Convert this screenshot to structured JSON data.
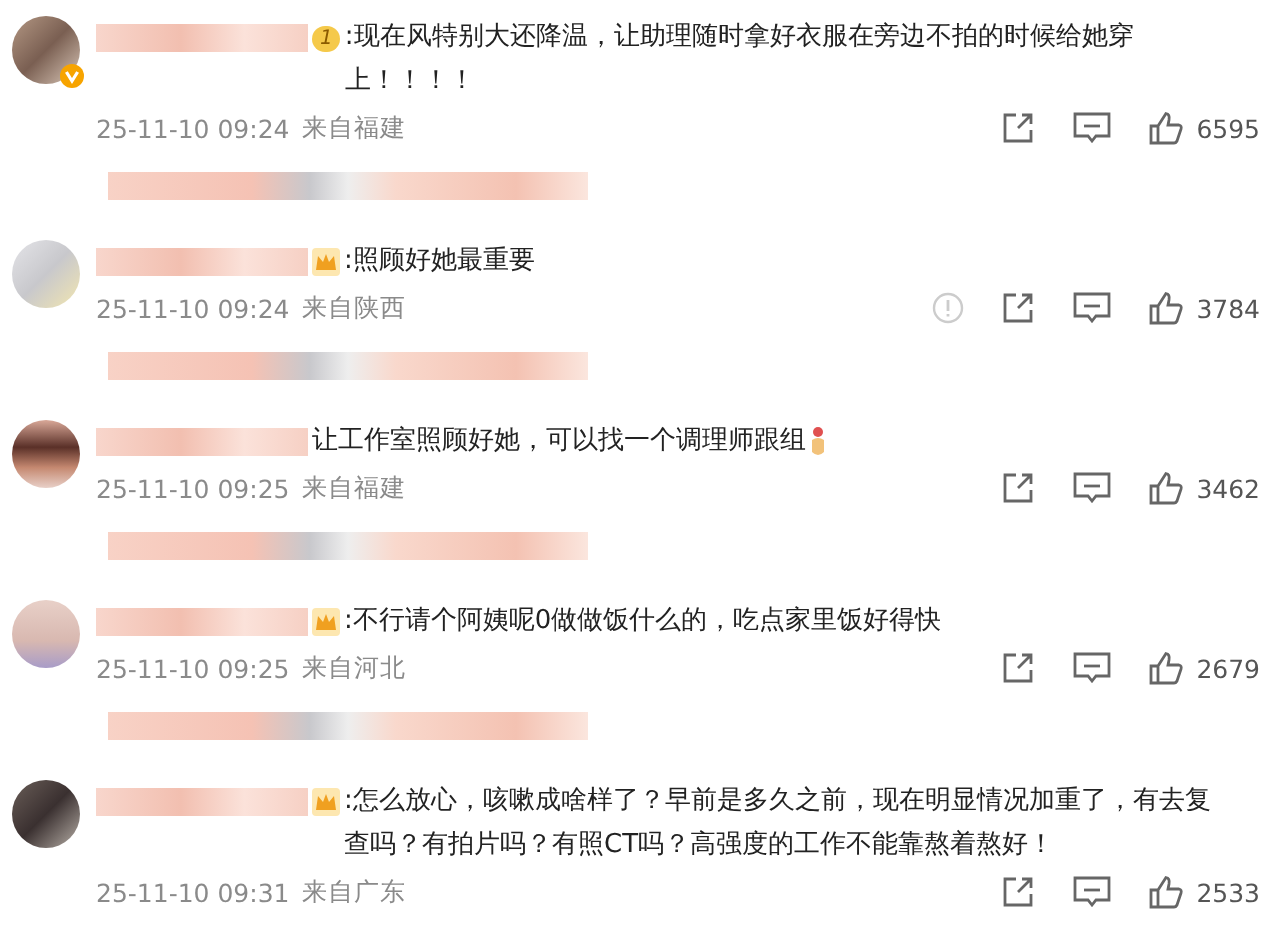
{
  "comments": [
    {
      "badge": {
        "kind": "level",
        "text": "1"
      },
      "verified": true,
      "text": ":现在风特别大还降温，让助理随时拿好衣服在旁边不拍的时候给她穿上！！！！",
      "trailing_emoji": false,
      "time": "25-11-10 09:24",
      "location": "来自福建",
      "report_icon": false,
      "likes": "6595"
    },
    {
      "badge": {
        "kind": "crown"
      },
      "verified": false,
      "text": ":照顾好她最重要",
      "trailing_emoji": false,
      "time": "25-11-10 09:24",
      "location": "来自陕西",
      "report_icon": true,
      "likes": "3784"
    },
    {
      "badge": {
        "kind": "none"
      },
      "verified": false,
      "text": "让工作室照顾好她，可以找一个调理师跟组",
      "trailing_emoji": true,
      "time": "25-11-10 09:25",
      "location": "来自福建",
      "report_icon": false,
      "likes": "3462"
    },
    {
      "badge": {
        "kind": "crown"
      },
      "verified": false,
      "text": ":不行请个阿姨呢0做做饭什么的，吃点家里饭好得快",
      "trailing_emoji": false,
      "time": "25-11-10 09:25",
      "location": "来自河北",
      "report_icon": false,
      "likes": "2679"
    },
    {
      "badge": {
        "kind": "crown"
      },
      "verified": false,
      "text": ":怎么放心，咳嗽成啥样了？早前是多久之前，现在明显情况加重了，有去复查吗？有拍片吗？有照CT吗？高强度的工作不能靠熬着熬好！",
      "trailing_emoji": false,
      "time": "25-11-10 09:31",
      "location": "来自广东",
      "report_icon": false,
      "likes": "2533"
    }
  ]
}
